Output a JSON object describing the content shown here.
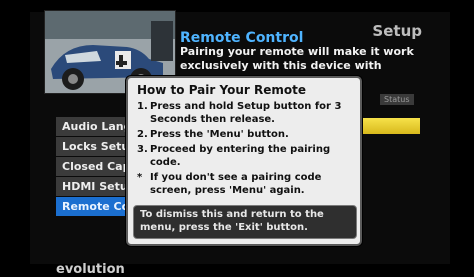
{
  "header": {
    "title": "Remote Control",
    "description": "Pairing your remote will make it work exclusively with this device with improved",
    "section_label": "Setup",
    "status_label": "Status"
  },
  "menu": {
    "items": [
      {
        "label": "Audio Lang"
      },
      {
        "label": "Locks Setu"
      },
      {
        "label": "Closed Cap"
      },
      {
        "label": "HDMI Setu"
      },
      {
        "label": "Remote Co"
      }
    ],
    "active_index": 4
  },
  "dialog": {
    "title": "How to Pair Your Remote",
    "steps": [
      {
        "marker": "1.",
        "text": "Press and hold Setup button for 3 Seconds then release."
      },
      {
        "marker": "2.",
        "text": "Press the 'Menu' button."
      },
      {
        "marker": "3.",
        "text": "Proceed by entering the pairing code."
      },
      {
        "marker": "*",
        "text": "If you don't see a pairing code screen, press 'Menu' again."
      }
    ],
    "footer": "To dismiss this and return to the menu, press the 'Exit' button."
  },
  "brand": "evolution",
  "colors": {
    "accent": "#4fb4ff",
    "active_menu": "#1b6fd0",
    "status_bar": "#f7e24a",
    "dialog_bg": "#ededed"
  }
}
